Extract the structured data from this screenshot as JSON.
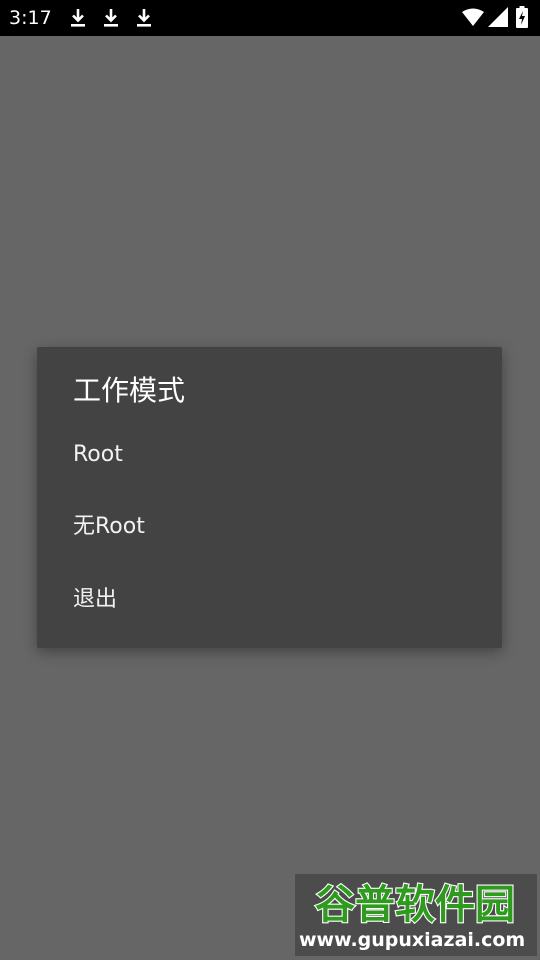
{
  "status_bar": {
    "time": "3:17",
    "notification_icons": [
      "download-icon",
      "download-icon",
      "download-icon"
    ],
    "system_icons": [
      "wifi-icon",
      "signal-icon",
      "battery-charging-icon"
    ]
  },
  "dialog": {
    "title": "工作模式",
    "options": [
      {
        "label": "Root"
      },
      {
        "label": "无Root"
      },
      {
        "label": "退出"
      }
    ]
  },
  "watermark": {
    "logo_text": "谷普软件园",
    "url": "www.gupuxiazai.com",
    "colors": {
      "logo_green": "#2e9b1f",
      "outline": "#ffffff"
    }
  },
  "colors": {
    "background": "#666666",
    "dialog_background": "#434343",
    "status_bar": "#000000",
    "text": "#ffffff"
  }
}
